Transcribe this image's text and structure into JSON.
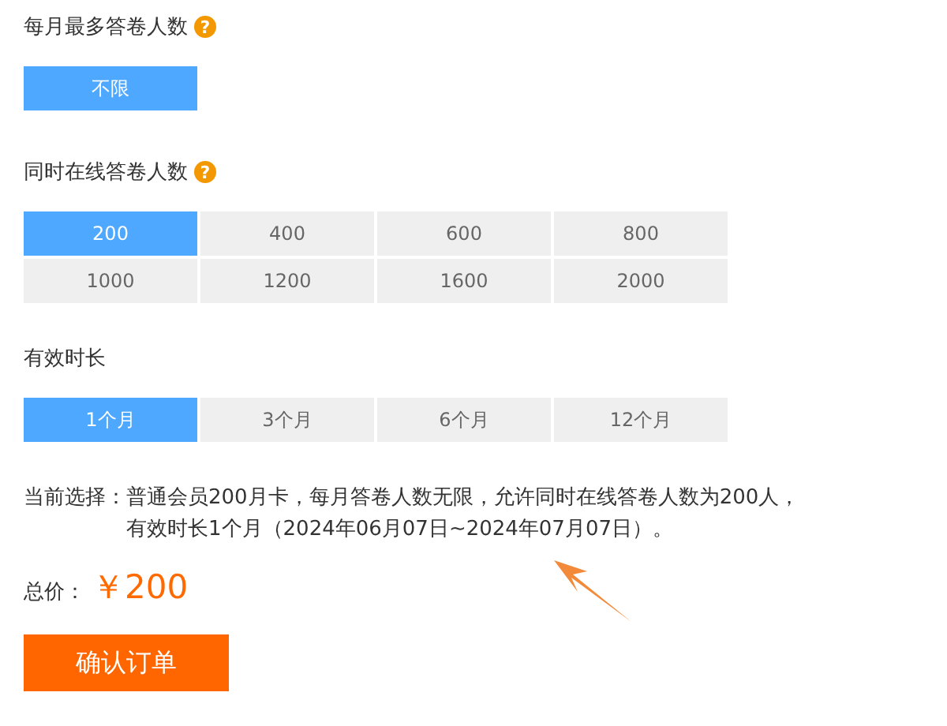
{
  "sections": [
    {
      "title": "每月最多答卷人数",
      "help": "?",
      "options": [
        {
          "label": "不限",
          "selected": true
        }
      ]
    },
    {
      "title": "同时在线答卷人数",
      "help": "?",
      "options": [
        {
          "label": "200",
          "selected": true
        },
        {
          "label": "400",
          "selected": false
        },
        {
          "label": "600",
          "selected": false
        },
        {
          "label": "800",
          "selected": false
        },
        {
          "label": "1000",
          "selected": false
        },
        {
          "label": "1200",
          "selected": false
        },
        {
          "label": "1600",
          "selected": false
        },
        {
          "label": "2000",
          "selected": false
        }
      ]
    },
    {
      "title": "有效时长",
      "options": [
        {
          "label": "1个月",
          "selected": true
        },
        {
          "label": "3个月",
          "selected": false
        },
        {
          "label": "6个月",
          "selected": false
        },
        {
          "label": "12个月",
          "selected": false
        }
      ]
    }
  ],
  "summary": {
    "label": "当前选择：",
    "text": "普通会员200月卡，每月答卷人数无限，允许同时在线答卷人数为200人，有效时长1个月（2024年06月07日~2024年07月07日）。"
  },
  "total": {
    "label": "总价：",
    "price": "￥200"
  },
  "confirm_button": "确认订单"
}
